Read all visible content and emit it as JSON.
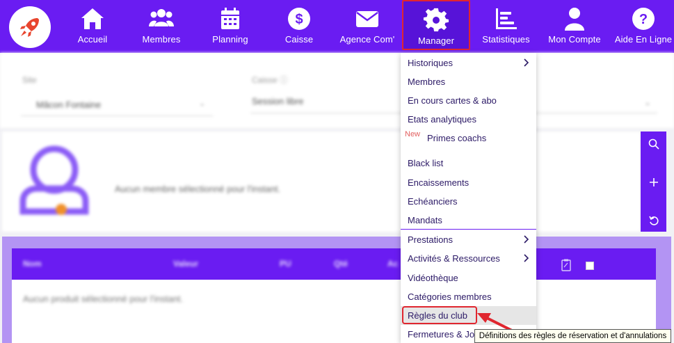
{
  "nav": {
    "items": [
      {
        "label": "Accueil",
        "icon": "home-icon"
      },
      {
        "label": "Membres",
        "icon": "users-icon"
      },
      {
        "label": "Planning",
        "icon": "calendar-icon"
      },
      {
        "label": "Caisse",
        "icon": "dollar-icon"
      },
      {
        "label": "Agence Com'",
        "icon": "envelope-icon"
      },
      {
        "label": "Manager",
        "icon": "gear-icon",
        "active": true
      },
      {
        "label": "Statistiques",
        "icon": "bar-chart-icon"
      },
      {
        "label": "Mon Compte",
        "icon": "user-icon"
      },
      {
        "label": "Aide En Ligne",
        "icon": "question-icon"
      }
    ],
    "accent": "#6a1cf2"
  },
  "filters": {
    "site_label": "Site",
    "site_value": "Mâcon Fontaine",
    "caisse_label": "Caisse ⓘ",
    "caisse_value": "Session libre"
  },
  "member": {
    "empty_text": "Aucun membre sélectionné pour l'instant."
  },
  "products": {
    "headers": [
      "Nom",
      "Valeur",
      "PU",
      "Qté",
      "Ac"
    ],
    "empty_text": "Aucun produit sélectionné pour l'instant."
  },
  "menu": {
    "items": [
      {
        "label": "Historiques",
        "submenu": true
      },
      {
        "label": "Membres"
      },
      {
        "label": "En cours cartes & abo"
      },
      {
        "label": "Etats analytiques"
      },
      {
        "label": "Primes coachs"
      },
      {
        "label": "Black list"
      },
      {
        "label": "Encaissements"
      },
      {
        "label": "Echéanciers"
      },
      {
        "label": "Mandats"
      },
      {
        "label": "Prestations",
        "submenu": true
      },
      {
        "label": "Activités & Ressources",
        "submenu": true
      },
      {
        "label": "Vidéothèque"
      },
      {
        "label": "Catégories membres"
      },
      {
        "label": "Règles du club",
        "highlighted": true
      },
      {
        "label": "Fermetures & Jo"
      }
    ],
    "new_badge": "New"
  },
  "tooltip": {
    "text": "Définitions des règles de réservation et d'annulations"
  },
  "colors": {
    "primary": "#6a1cf2",
    "highlight": "#e0262f",
    "menu_text": "#2b1966"
  }
}
